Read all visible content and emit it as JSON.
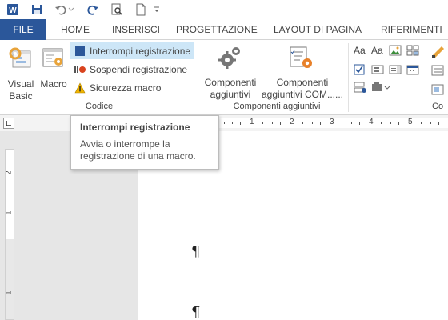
{
  "colors": {
    "accent": "#2b579a",
    "macro_record": "#2b579a",
    "hover": "#cde6f7"
  },
  "qat": {
    "icons": [
      "word-icon",
      "save-icon",
      "undo-icon",
      "redo-icon",
      "print-preview-icon",
      "new-document-icon",
      "customize-qat-icon"
    ]
  },
  "tabs": [
    {
      "label": "FILE",
      "active": false
    },
    {
      "label": "HOME"
    },
    {
      "label": "INSERISCI"
    },
    {
      "label": "PROGETTAZIONE"
    },
    {
      "label": "LAYOUT DI PAGINA"
    },
    {
      "label": "RIFERIMENTI"
    }
  ],
  "ribbon": {
    "code_group": {
      "label": "Codice",
      "visual_basic_label": "Visual\nBasic",
      "macro_label": "Macro",
      "stop_recording_label": "Interrompi registrazione",
      "pause_recording_label": "Sospendi registrazione",
      "macro_security_label": "Sicurezza macro"
    },
    "addins_group": {
      "label": "Componenti aggiuntivi",
      "addins_label": "Componenti\naggiuntivi",
      "com_addins_label": "Componenti\naggiuntivi COM......"
    },
    "controls_group": {
      "label_partial": "Co"
    }
  },
  "ruler": {
    "marks": [
      "1",
      "2",
      "3",
      "4",
      "5"
    ],
    "vertical_marks": [
      "2",
      "1",
      "1"
    ]
  },
  "tooltip": {
    "title": "Interrompi registrazione",
    "body": "Avvia o interrompe la registrazione di una macro."
  },
  "document": {
    "paragraph_mark": "¶"
  }
}
